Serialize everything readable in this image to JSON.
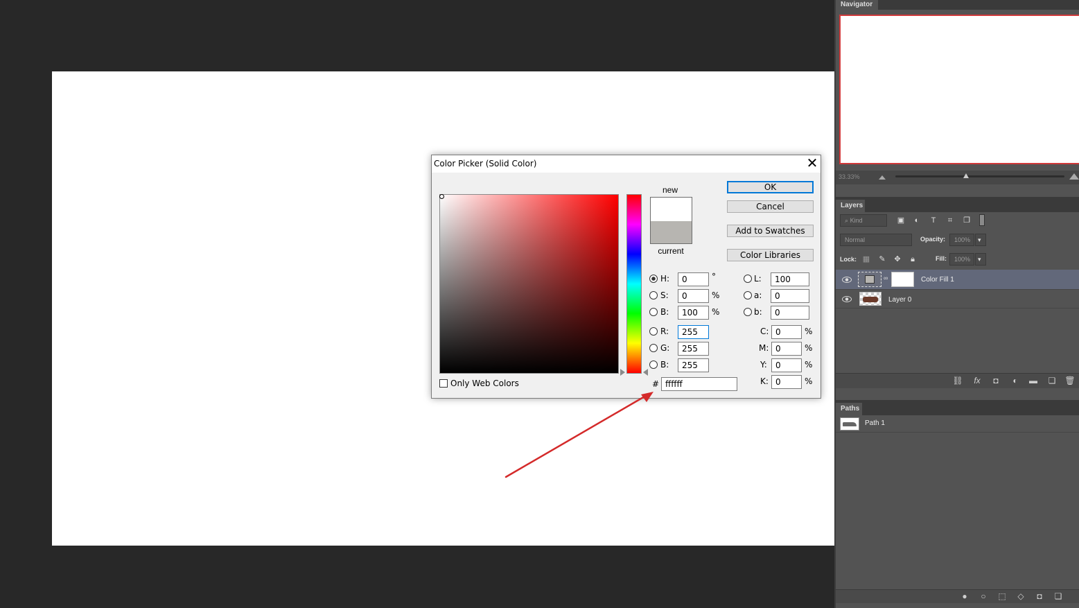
{
  "navigator": {
    "tab": "Navigator",
    "zoom": "33.33%"
  },
  "layers": {
    "tab": "Layers",
    "filter": "Kind",
    "blend_mode": "Normal",
    "opacity_label": "Opacity:",
    "opacity_value": "100%",
    "lock_label": "Lock:",
    "fill_label": "Fill:",
    "fill_value": "100%",
    "items": [
      {
        "name": "Color Fill 1",
        "selected": true
      },
      {
        "name": "Layer 0",
        "selected": false
      }
    ]
  },
  "paths": {
    "tab": "Paths",
    "items": [
      {
        "name": "Path 1"
      }
    ]
  },
  "color_picker": {
    "title": "Color Picker (Solid Color)",
    "close": "✕",
    "new_label": "new",
    "current_label": "current",
    "new_color": "#ffffff",
    "current_color": "#b7b5b1",
    "buttons": {
      "ok": "OK",
      "cancel": "Cancel",
      "add_to_swatches": "Add to Swatches",
      "color_libraries": "Color Libraries"
    },
    "hsb": {
      "h": "0",
      "s": "0",
      "b": "100",
      "h_unit": "°",
      "pct": "%"
    },
    "rgb": {
      "r": "255",
      "g": "255",
      "b": "255"
    },
    "lab": {
      "l": "100",
      "a": "0",
      "b": "0"
    },
    "cmyk": {
      "c": "0",
      "m": "0",
      "y": "0",
      "k": "0"
    },
    "labels": {
      "H": "H:",
      "S": "S:",
      "B": "B:",
      "R": "R:",
      "G": "G:",
      "B2": "B:",
      "L": "L:",
      "a": "a:",
      "b": "b:",
      "C": "C:",
      "M": "M:",
      "Y": "Y:",
      "K": "K:",
      "hash": "#"
    },
    "hex": "ffffff",
    "only_web_colors": "Only Web Colors"
  },
  "annotation": {
    "arrow_color": "#d42a2a"
  }
}
